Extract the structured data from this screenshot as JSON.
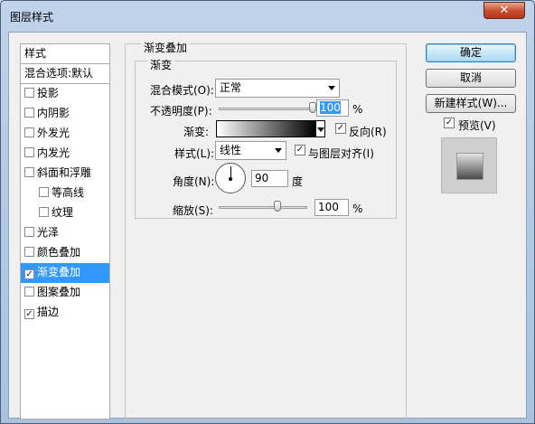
{
  "window": {
    "title": "图层样式",
    "close_label": "✕"
  },
  "sidebar": {
    "header": "样式",
    "blend_default": "混合选项:默认",
    "items": [
      {
        "label": "投影",
        "checked": false
      },
      {
        "label": "内阴影",
        "checked": false
      },
      {
        "label": "外发光",
        "checked": false
      },
      {
        "label": "内发光",
        "checked": false
      },
      {
        "label": "斜面和浮雕",
        "checked": false
      },
      {
        "label": "等高线",
        "checked": false
      },
      {
        "label": "纹理",
        "checked": false
      },
      {
        "label": "光泽",
        "checked": false
      },
      {
        "label": "颜色叠加",
        "checked": false
      },
      {
        "label": "渐变叠加",
        "checked": true
      },
      {
        "label": "图案叠加",
        "checked": false
      },
      {
        "label": "描边",
        "checked": true
      }
    ]
  },
  "panel": {
    "outer_title": "渐变叠加",
    "inner_title": "渐变",
    "blend_mode_label": "混合模式(O):",
    "blend_mode_value": "正常",
    "opacity_label": "不透明度(P):",
    "opacity_value": "100",
    "opacity_unit": "%",
    "opacity_fraction": 1.0,
    "gradient_label": "渐变:",
    "reverse_label": "反向(R)",
    "reverse_checked": true,
    "style_label": "样式(L):",
    "style_value": "线性",
    "align_label": "与图层对齐(I)",
    "align_checked": true,
    "angle_label": "角度(N):",
    "angle_value": "90",
    "angle_unit": "度",
    "scale_label": "缩放(S):",
    "scale_value": "100",
    "scale_unit": "%",
    "scale_fraction": 0.66
  },
  "buttons": {
    "ok": "确定",
    "cancel": "取消",
    "new_style": "新建样式(W)...",
    "preview_label": "预览(V)",
    "preview_checked": true
  }
}
